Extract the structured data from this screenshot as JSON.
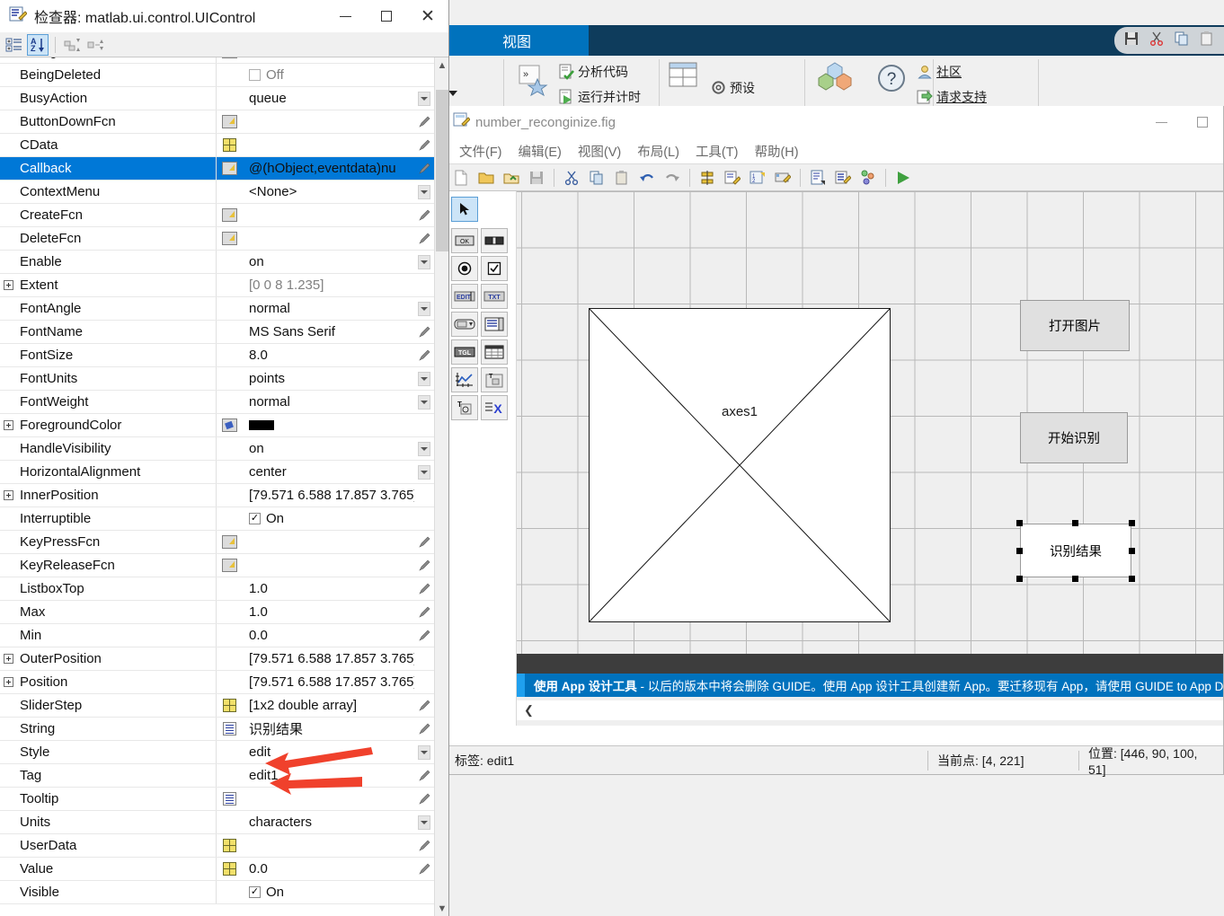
{
  "desktop": {
    "tab_label": "视图",
    "ribbon": {
      "analyze_code": "分析代码",
      "run_and_time": "运行并计时",
      "preferences": "预设",
      "community": "社区",
      "request_support": "请求支持"
    },
    "quick_access": [
      "save-icon",
      "cut-icon",
      "copy-icon",
      "paste-icon"
    ]
  },
  "guide": {
    "title": "number_reconginize.fig",
    "window_buttons": [
      "minimize-icon",
      "maximize-icon"
    ],
    "menus": [
      "文件(F)",
      "编辑(E)",
      "视图(V)",
      "布局(L)",
      "工具(T)",
      "帮助(H)"
    ],
    "toolbar_icons": [
      "new-icon",
      "open-icon",
      "save-as-icon",
      "save-icon",
      "cut-icon",
      "copy-icon",
      "paste-icon",
      "undo-icon",
      "redo-icon",
      "align-objects-icon",
      "menu-editor-icon",
      "tab-order-editor-icon",
      "toolbar-editor-icon",
      "m-file-editor-icon",
      "property-inspector-icon",
      "object-browser-icon",
      "run-icon"
    ],
    "palette": [
      [
        "select-arrow-icon"
      ],
      [
        "push-button-icon",
        "slider-icon"
      ],
      [
        "radio-button-icon",
        "checkbox-icon"
      ],
      [
        "edit-text-icon",
        "static-text-icon"
      ],
      [
        "popup-menu-icon",
        "listbox-icon"
      ],
      [
        "toggle-button-icon",
        "table-icon"
      ],
      [
        "axes-icon",
        "panel-icon"
      ],
      [
        "button-group-icon",
        "activex-control-icon"
      ]
    ],
    "canvas": {
      "axes_label": "axes1",
      "open_image_button": "打开图片",
      "start_recognize_button": "开始识别",
      "result_edit_value": "识别结果"
    },
    "banner": {
      "bold": "使用 App 设计工具",
      "rest": " - 以后的版本中将会删除 GUIDE。使用 App 设计工具创建新 App。要迁移现有 App，请使用 GUIDE to App Designer Migrati"
    },
    "status": {
      "tag": "标签: edit1",
      "current_point": "当前点: [4, 221]",
      "position": "位置: [446, 90, 100, 51]"
    }
  },
  "inspector": {
    "title": "检查器: matlab.ui.control.UIControl",
    "toolbar_icons": [
      "category-sort-icon",
      "alpha-sort-icon",
      "expand-all-icon",
      "collapse-all-icon"
    ],
    "window_buttons": [
      "minimize-icon",
      "maximize-icon",
      "close-icon"
    ],
    "properties": [
      {
        "name": "BackgroundColor",
        "expandable": true,
        "icon": "bucket-icon",
        "value": "",
        "swatch": "white",
        "tail": ""
      },
      {
        "name": "BeingDeleted",
        "expandable": false,
        "icon": "",
        "value": "Off",
        "check": "off",
        "grey": true,
        "tail": ""
      },
      {
        "name": "BusyAction",
        "expandable": false,
        "icon": "",
        "value": "queue",
        "tail": "caret"
      },
      {
        "name": "ButtonDownFcn",
        "expandable": false,
        "icon": "pen-icon",
        "value": "",
        "tail": "pencil"
      },
      {
        "name": "CData",
        "expandable": false,
        "icon": "grid-icon",
        "value": "",
        "tail": "pencil"
      },
      {
        "name": "Callback",
        "expandable": false,
        "icon": "pen-icon",
        "value": "@(hObject,eventdata)nu",
        "tail": "pencil",
        "selected": true
      },
      {
        "name": "ContextMenu",
        "expandable": false,
        "icon": "",
        "value": "<None>",
        "tail": "caret"
      },
      {
        "name": "CreateFcn",
        "expandable": false,
        "icon": "pen-icon",
        "value": "",
        "tail": "pencil"
      },
      {
        "name": "DeleteFcn",
        "expandable": false,
        "icon": "pen-icon",
        "value": "",
        "tail": "pencil"
      },
      {
        "name": "Enable",
        "expandable": false,
        "icon": "",
        "value": "on",
        "tail": "caret"
      },
      {
        "name": "Extent",
        "expandable": true,
        "icon": "",
        "value": "[0 0 8 1.235]",
        "grey": true,
        "tail": ""
      },
      {
        "name": "FontAngle",
        "expandable": false,
        "icon": "",
        "value": "normal",
        "tail": "caret"
      },
      {
        "name": "FontName",
        "expandable": false,
        "icon": "",
        "value": "MS Sans Serif",
        "tail": "pencil"
      },
      {
        "name": "FontSize",
        "expandable": false,
        "icon": "",
        "value": "8.0",
        "tail": "pencil"
      },
      {
        "name": "FontUnits",
        "expandable": false,
        "icon": "",
        "value": "points",
        "tail": "caret"
      },
      {
        "name": "FontWeight",
        "expandable": false,
        "icon": "",
        "value": "normal",
        "tail": "caret"
      },
      {
        "name": "ForegroundColor",
        "expandable": true,
        "icon": "bucket-icon",
        "value": "",
        "swatch": "black",
        "tail": ""
      },
      {
        "name": "HandleVisibility",
        "expandable": false,
        "icon": "",
        "value": "on",
        "tail": "caret"
      },
      {
        "name": "HorizontalAlignment",
        "expandable": false,
        "icon": "",
        "value": "center",
        "tail": "caret"
      },
      {
        "name": "InnerPosition",
        "expandable": true,
        "icon": "",
        "value": "[79.571 6.588 17.857 3.765]",
        "tail": ""
      },
      {
        "name": "Interruptible",
        "expandable": false,
        "icon": "",
        "value": "On",
        "check": "on",
        "tail": ""
      },
      {
        "name": "KeyPressFcn",
        "expandable": false,
        "icon": "pen-icon",
        "value": "",
        "tail": "pencil"
      },
      {
        "name": "KeyReleaseFcn",
        "expandable": false,
        "icon": "pen-icon",
        "value": "",
        "tail": "pencil"
      },
      {
        "name": "ListboxTop",
        "expandable": false,
        "icon": "",
        "value": "1.0",
        "tail": "pencil"
      },
      {
        "name": "Max",
        "expandable": false,
        "icon": "",
        "value": "1.0",
        "tail": "pencil"
      },
      {
        "name": "Min",
        "expandable": false,
        "icon": "",
        "value": "0.0",
        "tail": "pencil"
      },
      {
        "name": "OuterPosition",
        "expandable": true,
        "icon": "",
        "value": "[79.571 6.588 17.857 3.765]",
        "tail": ""
      },
      {
        "name": "Position",
        "expandable": true,
        "icon": "",
        "value": "[79.571 6.588 17.857 3.765]",
        "tail": ""
      },
      {
        "name": "SliderStep",
        "expandable": false,
        "icon": "grid-icon",
        "value": "[1x2  double array]",
        "tail": "pencil"
      },
      {
        "name": "String",
        "expandable": false,
        "icon": "text-icon",
        "value": "识别结果",
        "tail": "pencil"
      },
      {
        "name": "Style",
        "expandable": false,
        "icon": "",
        "value": "edit",
        "tail": "caret"
      },
      {
        "name": "Tag",
        "expandable": false,
        "icon": "",
        "value": "edit1",
        "tail": "pencil"
      },
      {
        "name": "Tooltip",
        "expandable": false,
        "icon": "text-icon",
        "value": "",
        "tail": "pencil"
      },
      {
        "name": "Units",
        "expandable": false,
        "icon": "",
        "value": "characters",
        "tail": "caret"
      },
      {
        "name": "UserData",
        "expandable": false,
        "icon": "grid-icon",
        "value": "",
        "tail": "pencil"
      },
      {
        "name": "Value",
        "expandable": false,
        "icon": "grid-icon",
        "value": "0.0",
        "tail": "pencil"
      },
      {
        "name": "Visible",
        "expandable": false,
        "icon": "",
        "value": "On",
        "check": "on",
        "tail": ""
      }
    ]
  },
  "annotations": {
    "arrow_color": "#f0412c",
    "arrows": [
      "style-row-arrow",
      "tag-row-arrow"
    ]
  }
}
